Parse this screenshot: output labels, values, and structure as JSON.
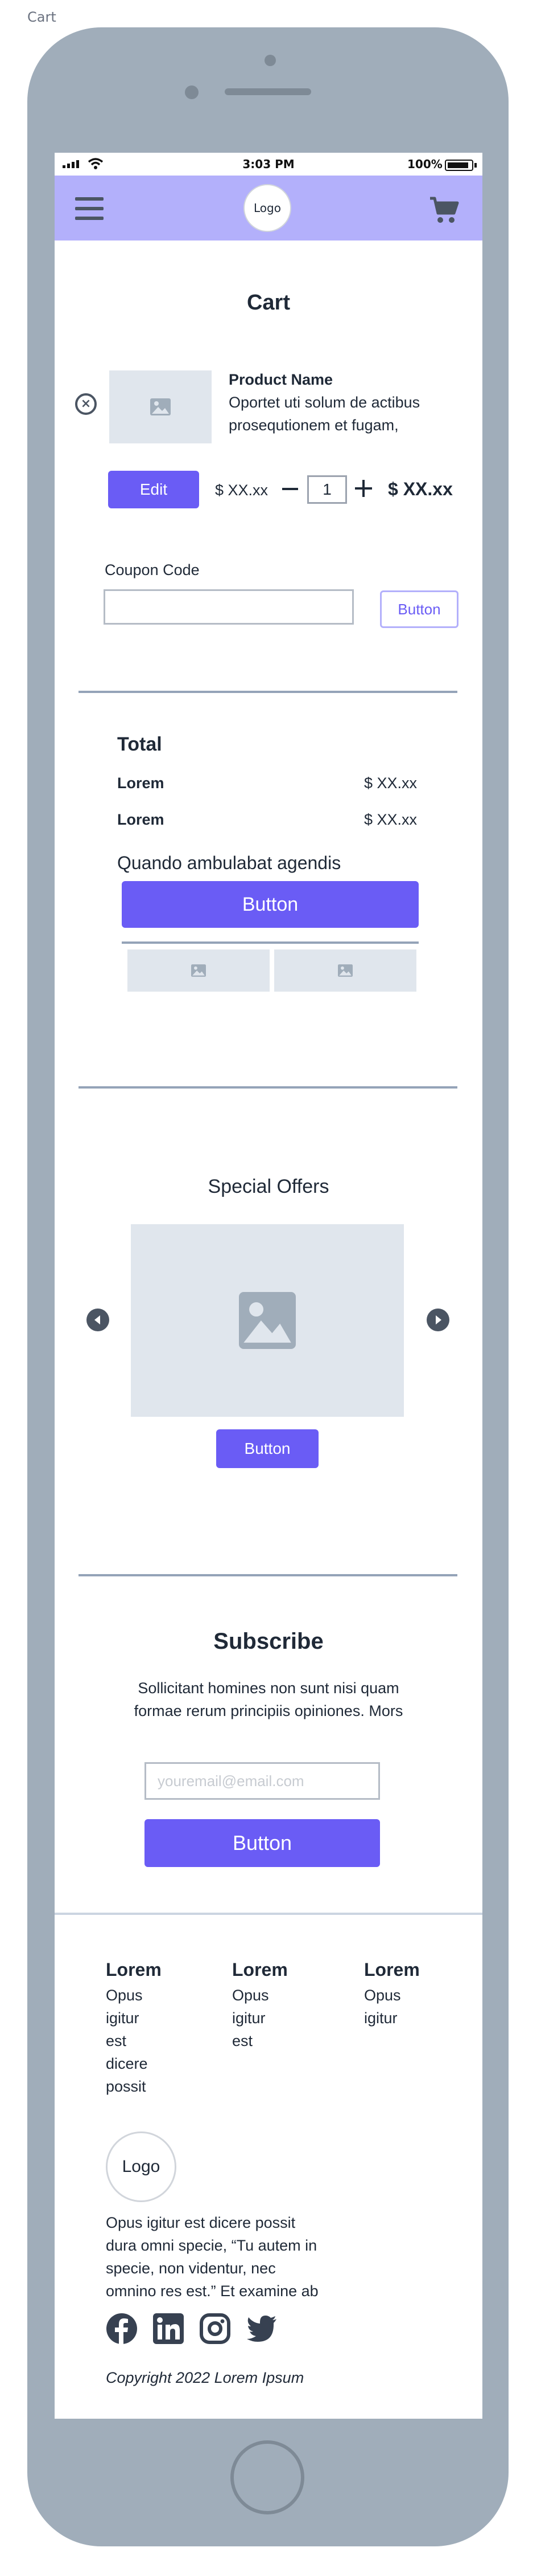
{
  "frame_label": "Cart",
  "status_bar": {
    "time": "3:03 PM",
    "battery": "100%"
  },
  "header": {
    "logo": "Logo",
    "menu_icon": "hamburger-menu-icon",
    "cart_icon": "shopping-cart-icon"
  },
  "cart": {
    "title": "Cart",
    "item": {
      "name": "Product Name",
      "description_lines": [
        "Oportet uti solum de actibus",
        "prosequtionem et fugam,"
      ],
      "edit_label": "Edit",
      "unit_price": "$ XX.xx",
      "quantity": "1",
      "line_total": "$ XX.xx"
    },
    "coupon": {
      "label": "Coupon Code",
      "value": "",
      "button_label": "Button"
    }
  },
  "totals": {
    "title": "Total",
    "rows": [
      {
        "label": "Lorem",
        "value": "$ XX.xx"
      },
      {
        "label": "Lorem",
        "value": "$ XX.xx"
      }
    ],
    "caption": "Quando ambulabat agendis",
    "button_label": "Button"
  },
  "offers": {
    "title": "Special Offers",
    "button_label": "Button"
  },
  "subscribe": {
    "title": "Subscribe",
    "text_lines": [
      "Sollicitant homines non sunt nisi quam",
      "formae rerum principiis opiniones. Mors"
    ],
    "email_placeholder": "youremail@email.com",
    "button_label": "Button"
  },
  "footer": {
    "columns": [
      {
        "title": "Lorem",
        "items": [
          "Opus",
          "igitur",
          "est",
          "dicere",
          "possit"
        ]
      },
      {
        "title": "Lorem",
        "items": [
          "Opus",
          "igitur",
          "est"
        ]
      },
      {
        "title": "Lorem",
        "items": [
          "Opus",
          "igitur"
        ]
      }
    ],
    "logo": "Logo",
    "about_lines": [
      "Opus igitur est dicere possit",
      "dura omni specie, “Tu autem in",
      "specie, non videntur, nec",
      "omnino res est.” Et examine ab"
    ],
    "social": [
      "facebook-icon",
      "linkedin-icon",
      "instagram-icon",
      "twitter-icon"
    ],
    "copyright": "Copyright 2022 Lorem Ipsum"
  },
  "colors": {
    "accent": "#6a5cf5",
    "header_bg": "#b3b0fb",
    "device": "#a0adba",
    "placeholder": "#e0e6ed"
  }
}
